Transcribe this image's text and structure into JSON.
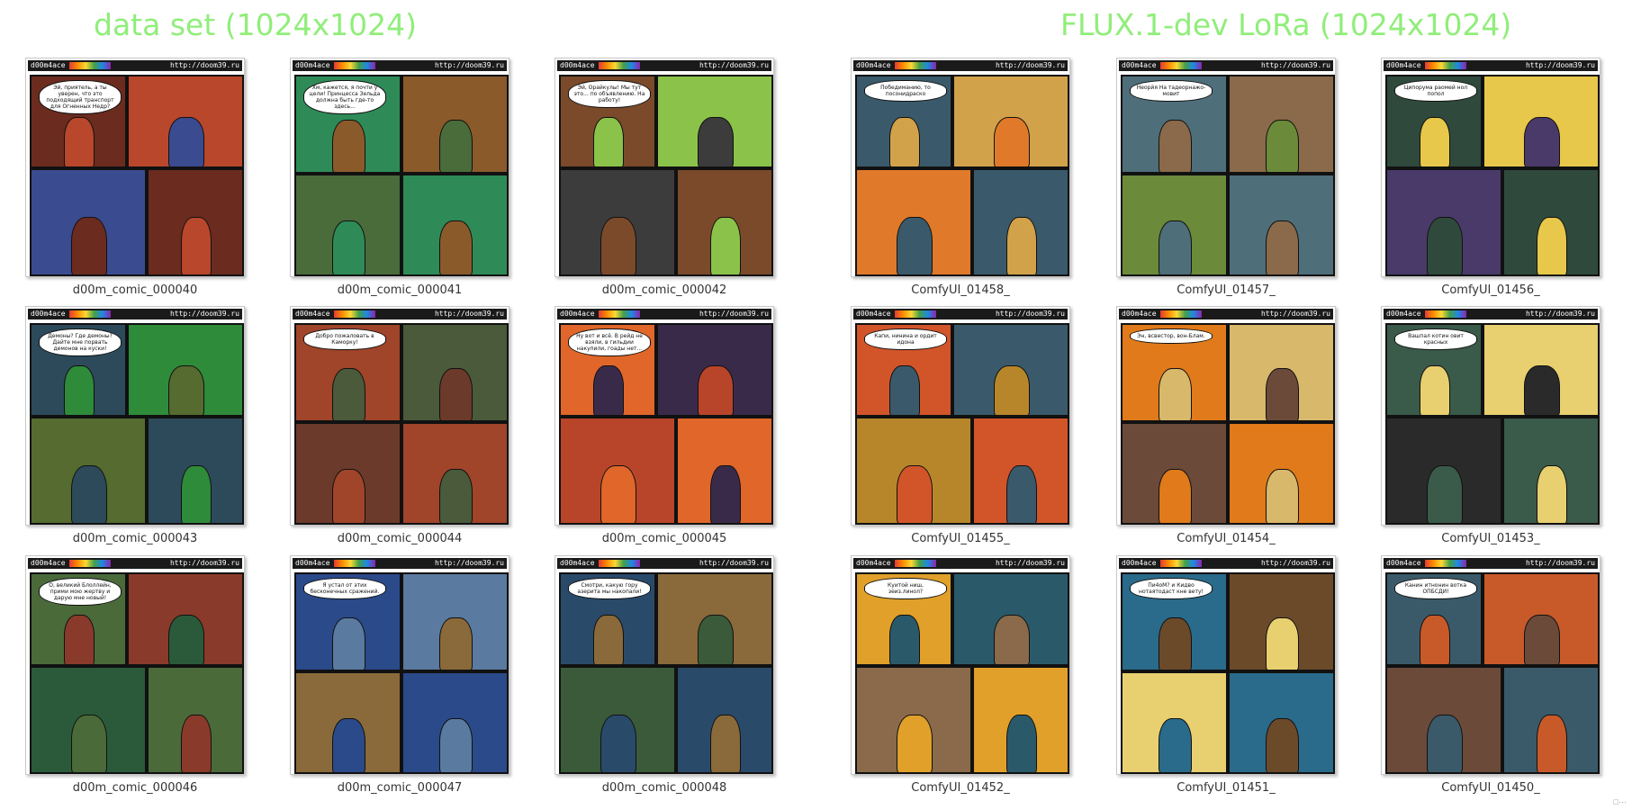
{
  "headings": {
    "left": "data set (1024x1024)",
    "right": "FLUX.1-dev LoRa (1024x1024)"
  },
  "colors": {
    "heading": "#90ee7a"
  },
  "comic_header": {
    "left_text": "d00m4ace",
    "url": "http://doom39.ru"
  },
  "thumbnails": [
    {
      "caption": "d00m_comic_000040",
      "bubble": "Эй, приятель, а ты уверен, что это подходящий транспорт для Огненных Недр?"
    },
    {
      "caption": "d00m_comic_000041",
      "bubble": "Хм, кажется, я почти у цели! Принцесса Зельда должна быть где-то здесь..."
    },
    {
      "caption": "d00m_comic_000042",
      "bubble": "Эй, Орайкулы! Мы тут это... по объявлению. На работу!"
    },
    {
      "caption": "ComfyUI_01458_",
      "bubble": "Победиманию, то посонидраско"
    },
    {
      "caption": "ComfyUI_01457_",
      "bubble": "Неорйя На тадеорнажо-мовит"
    },
    {
      "caption": "ComfyUI_01456_",
      "bubble": "Ципорума раомей нол попол"
    },
    {
      "caption": "d00m_comic_000043",
      "bubble": "Демоны? Где демоны? Дайте мне порвать демонов на куски!"
    },
    {
      "caption": "d00m_comic_000044",
      "bubble": "Добро пожаловать в Каморку!"
    },
    {
      "caption": "d00m_comic_000045",
      "bubble": "Ну вот и всё. В рейд не взяли, в гильдии накупили, гоады нет..."
    },
    {
      "caption": "ComfyUI_01455_",
      "bubble": "Капи, нинина и ордит идона"
    },
    {
      "caption": "ComfyUI_01454_",
      "bubble": "Эн, всвестор, вон-Блам."
    },
    {
      "caption": "ComfyUI_01453_",
      "bubble": "Вашпал котин овит красных"
    },
    {
      "caption": "d00m_comic_000046",
      "bubble": "О, великий Блоллейн, прими мою жертву и дарую мне новый!"
    },
    {
      "caption": "d00m_comic_000047",
      "bubble": "Я устал от этих бесконечных сражений."
    },
    {
      "caption": "d00m_comic_000048",
      "bubble": "Смотри, какую гору азерита мы накопали!"
    },
    {
      "caption": "ComfyUI_01452_",
      "bubble": "Куитой ниш, зеиз.линол?"
    },
    {
      "caption": "ComfyUI_01451_",
      "bubble": "Пи4оМ? и Кидво нотаятодаст кне вету!"
    },
    {
      "caption": "ComfyUI_01450_",
      "bubble": "Канин итнонин вотка ОПБСДИ!"
    }
  ],
  "corner_text": "□···"
}
